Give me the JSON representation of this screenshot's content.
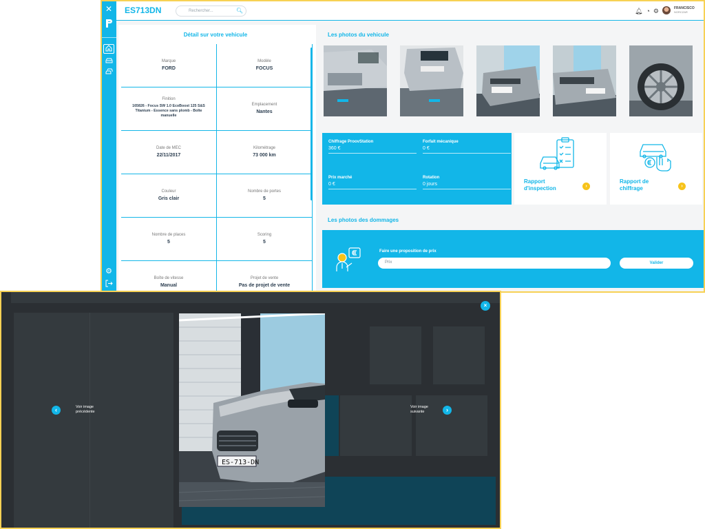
{
  "app": {
    "plate": "ES713DN",
    "search_placeholder": "Rechercher...",
    "user": {
      "first_name": "FRANCISCO",
      "last_name": "NORCZAR"
    }
  },
  "vehicle_details": {
    "title": "Détail sur votre vehicule",
    "fields": [
      {
        "label": "Marque",
        "value": "FORD"
      },
      {
        "label": "Modèle",
        "value": "FOCUS"
      },
      {
        "label": "Finition",
        "value": "165826 - Focus SW 1.0 EcoBoost 125 S&S Titanium - Essence sans plomb - Boîte manuelle"
      },
      {
        "label": "Emplacement",
        "value": "Nantes"
      },
      {
        "label": "Date de MEC",
        "value": "22/11/2017"
      },
      {
        "label": "Kilométrage",
        "value": "73 000 km"
      },
      {
        "label": "Couleur",
        "value": "Gris clair"
      },
      {
        "label": "Nombre de portes",
        "value": "5"
      },
      {
        "label": "Nombre de places",
        "value": "5"
      },
      {
        "label": "Scoring",
        "value": "5"
      },
      {
        "label": "Boîte de vitesse",
        "value": "Manual"
      },
      {
        "label": "Projet de vente",
        "value": "Pas de projet de vente"
      }
    ]
  },
  "photos": {
    "title": "Les photos du vehicule"
  },
  "estimate": {
    "items": [
      {
        "label": "Chiffrage ProovStation",
        "value": "360 €"
      },
      {
        "label": "Forfait mécanique",
        "value": "0 €"
      },
      {
        "label": "Prix marché",
        "value": "0 €"
      },
      {
        "label": "Rotation",
        "value": "0 jours"
      }
    ]
  },
  "reports": [
    {
      "line1": "Rapport",
      "line2": "d'inspection"
    },
    {
      "line1": "Rapport de",
      "line2": "chiffrage"
    }
  ],
  "damages": {
    "title": "Les photos des dommages"
  },
  "offer": {
    "title": "Faire une proposition de prix",
    "price_placeholder": "Prix",
    "submit_label": "Valider"
  },
  "viewer": {
    "prev_line1": "Voir image",
    "prev_line2": "précédente",
    "next_line1": "Voir image",
    "next_line2": "suivante",
    "close_symbol": "×",
    "prev_symbol": "‹",
    "next_symbol": "›"
  },
  "colors": {
    "accent": "#12b6e8",
    "highlight": "#f7c31a",
    "frame": "#f7d154"
  }
}
